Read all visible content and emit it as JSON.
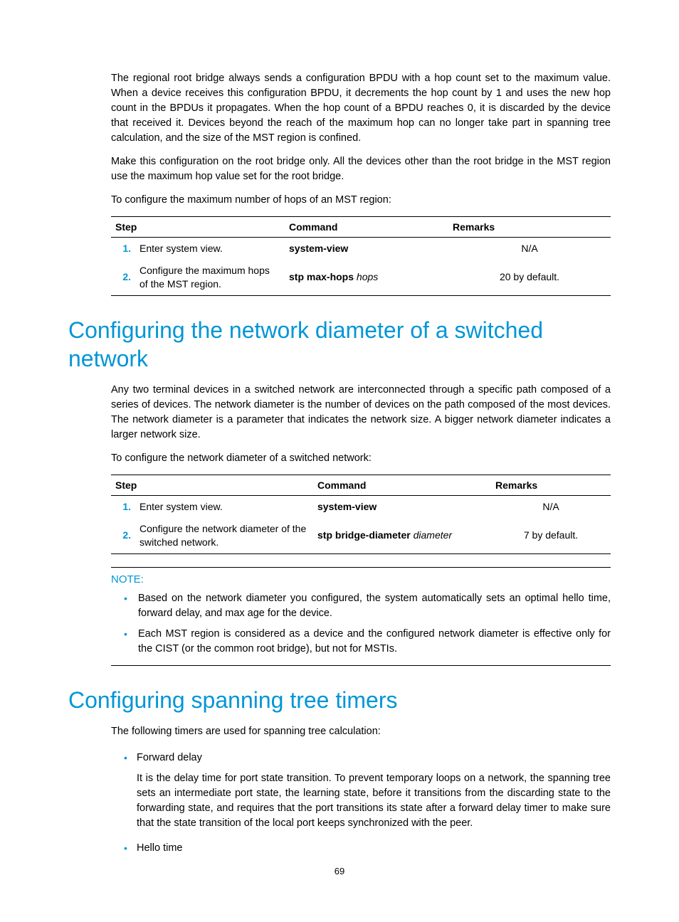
{
  "intro": {
    "p1": "The regional root bridge always sends a configuration BPDU with a hop count set to the maximum value. When a device receives this configuration BPDU, it decrements the hop count by 1 and uses the new hop count in the BPDUs it propagates. When the hop count of a BPDU reaches 0, it is discarded by the device that received it. Devices beyond the reach of the maximum hop can no longer take part in spanning tree calculation, and the size of the MST region is confined.",
    "p2": "Make this configuration on the root bridge only. All the devices other than the root bridge in the MST region use the maximum hop value set for the root bridge.",
    "p3": "To configure the maximum number of hops of an MST region:"
  },
  "table1": {
    "headers": {
      "step": "Step",
      "command": "Command",
      "remarks": "Remarks"
    },
    "rows": [
      {
        "num": "1.",
        "desc": "Enter system view.",
        "cmd_bold": "system-view",
        "cmd_italic": "",
        "remarks": "N/A"
      },
      {
        "num": "2.",
        "desc": "Configure the maximum hops of the MST region.",
        "cmd_bold": "stp max-hops",
        "cmd_italic": "hops",
        "remarks": "20 by default."
      }
    ]
  },
  "section1": {
    "heading": "Configuring the network diameter of a switched network",
    "p1": "Any two terminal devices in a switched network are interconnected through a specific path composed of a series of devices. The network diameter is the number of devices on the path composed of the most devices. The network diameter is a parameter that indicates the network size. A bigger network diameter indicates a larger network size.",
    "p2": "To configure the network diameter of a switched network:"
  },
  "table2": {
    "headers": {
      "step": "Step",
      "command": "Command",
      "remarks": "Remarks"
    },
    "rows": [
      {
        "num": "1.",
        "desc": "Enter system view.",
        "cmd_bold": "system-view",
        "cmd_italic": "",
        "remarks": "N/A"
      },
      {
        "num": "2.",
        "desc": "Configure the network diameter of the switched network.",
        "cmd_bold": "stp bridge-diameter",
        "cmd_italic": "diameter",
        "remarks": "7 by default."
      }
    ]
  },
  "note": {
    "label": "NOTE:",
    "items": [
      "Based on the network diameter you configured, the system automatically sets an optimal hello time, forward delay, and max age for the device.",
      "Each MST region is considered as a device and the configured network diameter is effective only for the CIST (or the common root bridge), but not for MSTIs."
    ]
  },
  "section2": {
    "heading": "Configuring spanning tree timers",
    "p1": "The following timers are used for spanning tree calculation:",
    "list": [
      {
        "label": "Forward delay",
        "desc": "It is the delay time for port state transition. To prevent temporary loops on a network, the spanning tree sets an intermediate port state, the learning state, before it transitions from the discarding state to the forwarding state, and requires that the port transitions its state after a forward delay timer to make sure that the state transition of the local port keeps synchronized with the peer."
      },
      {
        "label": "Hello time",
        "desc": ""
      }
    ]
  },
  "page_number": "69"
}
